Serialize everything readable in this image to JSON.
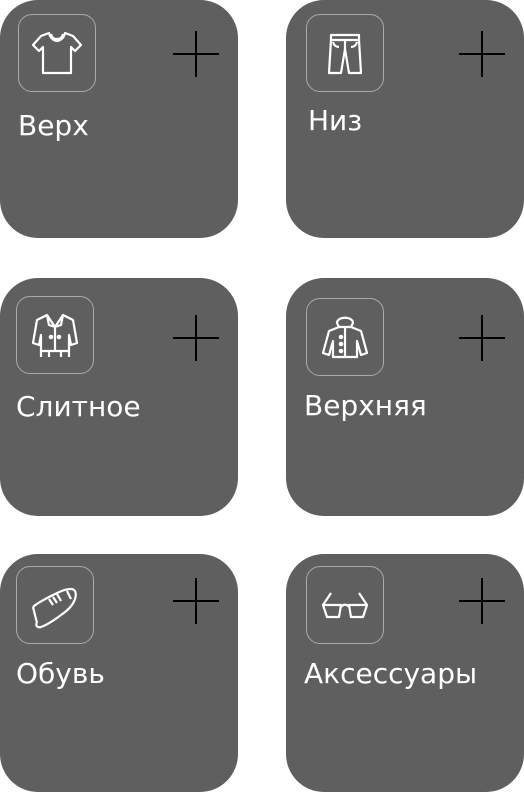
{
  "categories": [
    {
      "label": "Верх",
      "icon": "tshirt-icon"
    },
    {
      "label": "Низ",
      "icon": "pants-icon"
    },
    {
      "label": "Слитное",
      "icon": "dress-icon"
    },
    {
      "label": "Верхняя",
      "icon": "jacket-icon"
    },
    {
      "label": "Обувь",
      "icon": "shoe-icon"
    },
    {
      "label": "Аксессуары",
      "icon": "glasses-icon"
    }
  ],
  "colors": {
    "card_background": "#5f5f5f",
    "icon_border": "#a9a9a9",
    "label_text": "#ffffff",
    "add_button": "#000000",
    "page_background": "#ffffff"
  }
}
